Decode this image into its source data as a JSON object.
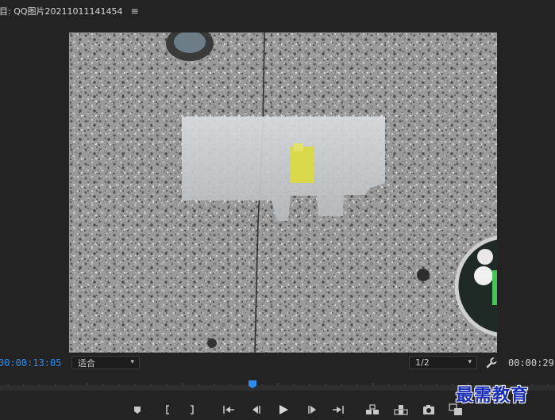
{
  "titlebar": {
    "title": "目: QQ图片20211011141454",
    "menu_icon": "hamburger-icon"
  },
  "monitor": {
    "timecode_current": "00:00:13:05",
    "zoom_value": "适合",
    "resolution_value": "1/2",
    "timecode_duration": "00:00:29:",
    "settings_icon": "wrench-icon"
  },
  "transport": {
    "buttons": [
      "add-marker-icon",
      "mark-in-icon",
      "mark-out-icon",
      "go-to-in-icon",
      "step-back-icon",
      "play-icon",
      "step-forward-icon",
      "go-to-out-icon",
      "insert-icon",
      "overwrite-icon",
      "export-frame-icon",
      "compare-icon"
    ]
  },
  "watermark": {
    "text": "最需教育"
  },
  "colors": {
    "accent_timecode": "#2d8ceb",
    "playhead": "#2d8ceb",
    "background": "#232323"
  }
}
